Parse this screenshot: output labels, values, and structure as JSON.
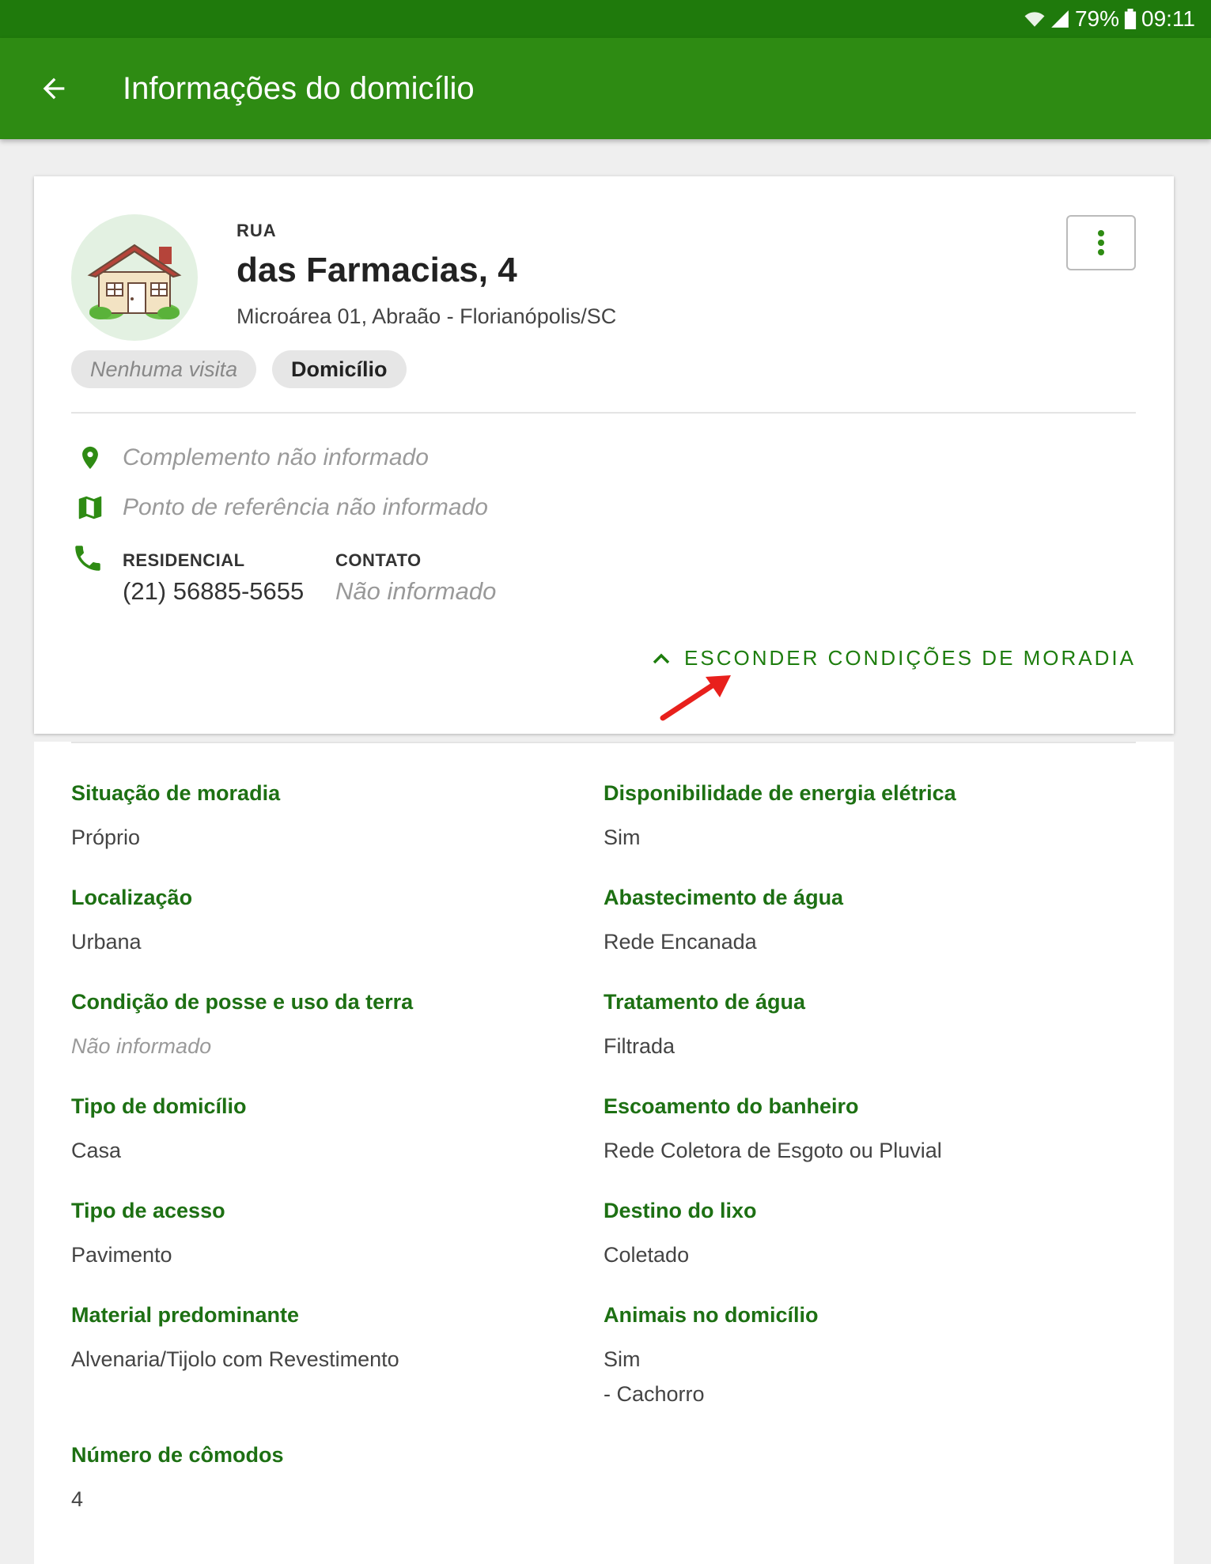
{
  "status_bar": {
    "battery": "79%",
    "time": "09:11"
  },
  "app_bar": {
    "title": "Informações do domicílio"
  },
  "household": {
    "street_type": "RUA",
    "street_name": "das Farmacias, 4",
    "address_line": "Microárea 01, Abraão - Florianópolis/SC",
    "chips": [
      "Nenhuma visita",
      "Domicílio"
    ],
    "complement": "Complemento não informado",
    "reference": "Ponto de referência não informado",
    "phones": {
      "residential_label": "RESIDENCIAL",
      "residential_value": "(21) 56885-5655",
      "contact_label": "CONTATO",
      "contact_value": "Não informado"
    },
    "toggle_label": "ESCONDER CONDIÇÕES DE MORADIA"
  },
  "conditions": {
    "left": [
      {
        "label": "Situação de moradia",
        "value": "Próprio"
      },
      {
        "label": "Localização",
        "value": "Urbana"
      },
      {
        "label": "Condição de posse e uso da terra",
        "value": "Não informado"
      },
      {
        "label": "Tipo de domicílio",
        "value": "Casa"
      },
      {
        "label": "Tipo de acesso",
        "value": "Pavimento"
      },
      {
        "label": "Material predominante",
        "value": "Alvenaria/Tijolo com Revestimento"
      },
      {
        "label": "Número de cômodos",
        "value": "4"
      }
    ],
    "right": [
      {
        "label": "Disponibilidade de energia elétrica",
        "value": "Sim"
      },
      {
        "label": "Abastecimento de água",
        "value": "Rede Encanada"
      },
      {
        "label": "Tratamento de água",
        "value": "Filtrada"
      },
      {
        "label": "Escoamento do banheiro",
        "value": "Rede Coletora de Esgoto ou Pluvial"
      },
      {
        "label": "Destino do lixo",
        "value": "Coletado"
      },
      {
        "label": "Animais no domicílio",
        "value": "Sim",
        "extra": "- Cachorro"
      }
    ]
  },
  "colors": {
    "primary": "#2e8b13",
    "status": "#1f7a0c",
    "label_green": "#1d7013",
    "annotation_arrow": "#e8201c"
  }
}
